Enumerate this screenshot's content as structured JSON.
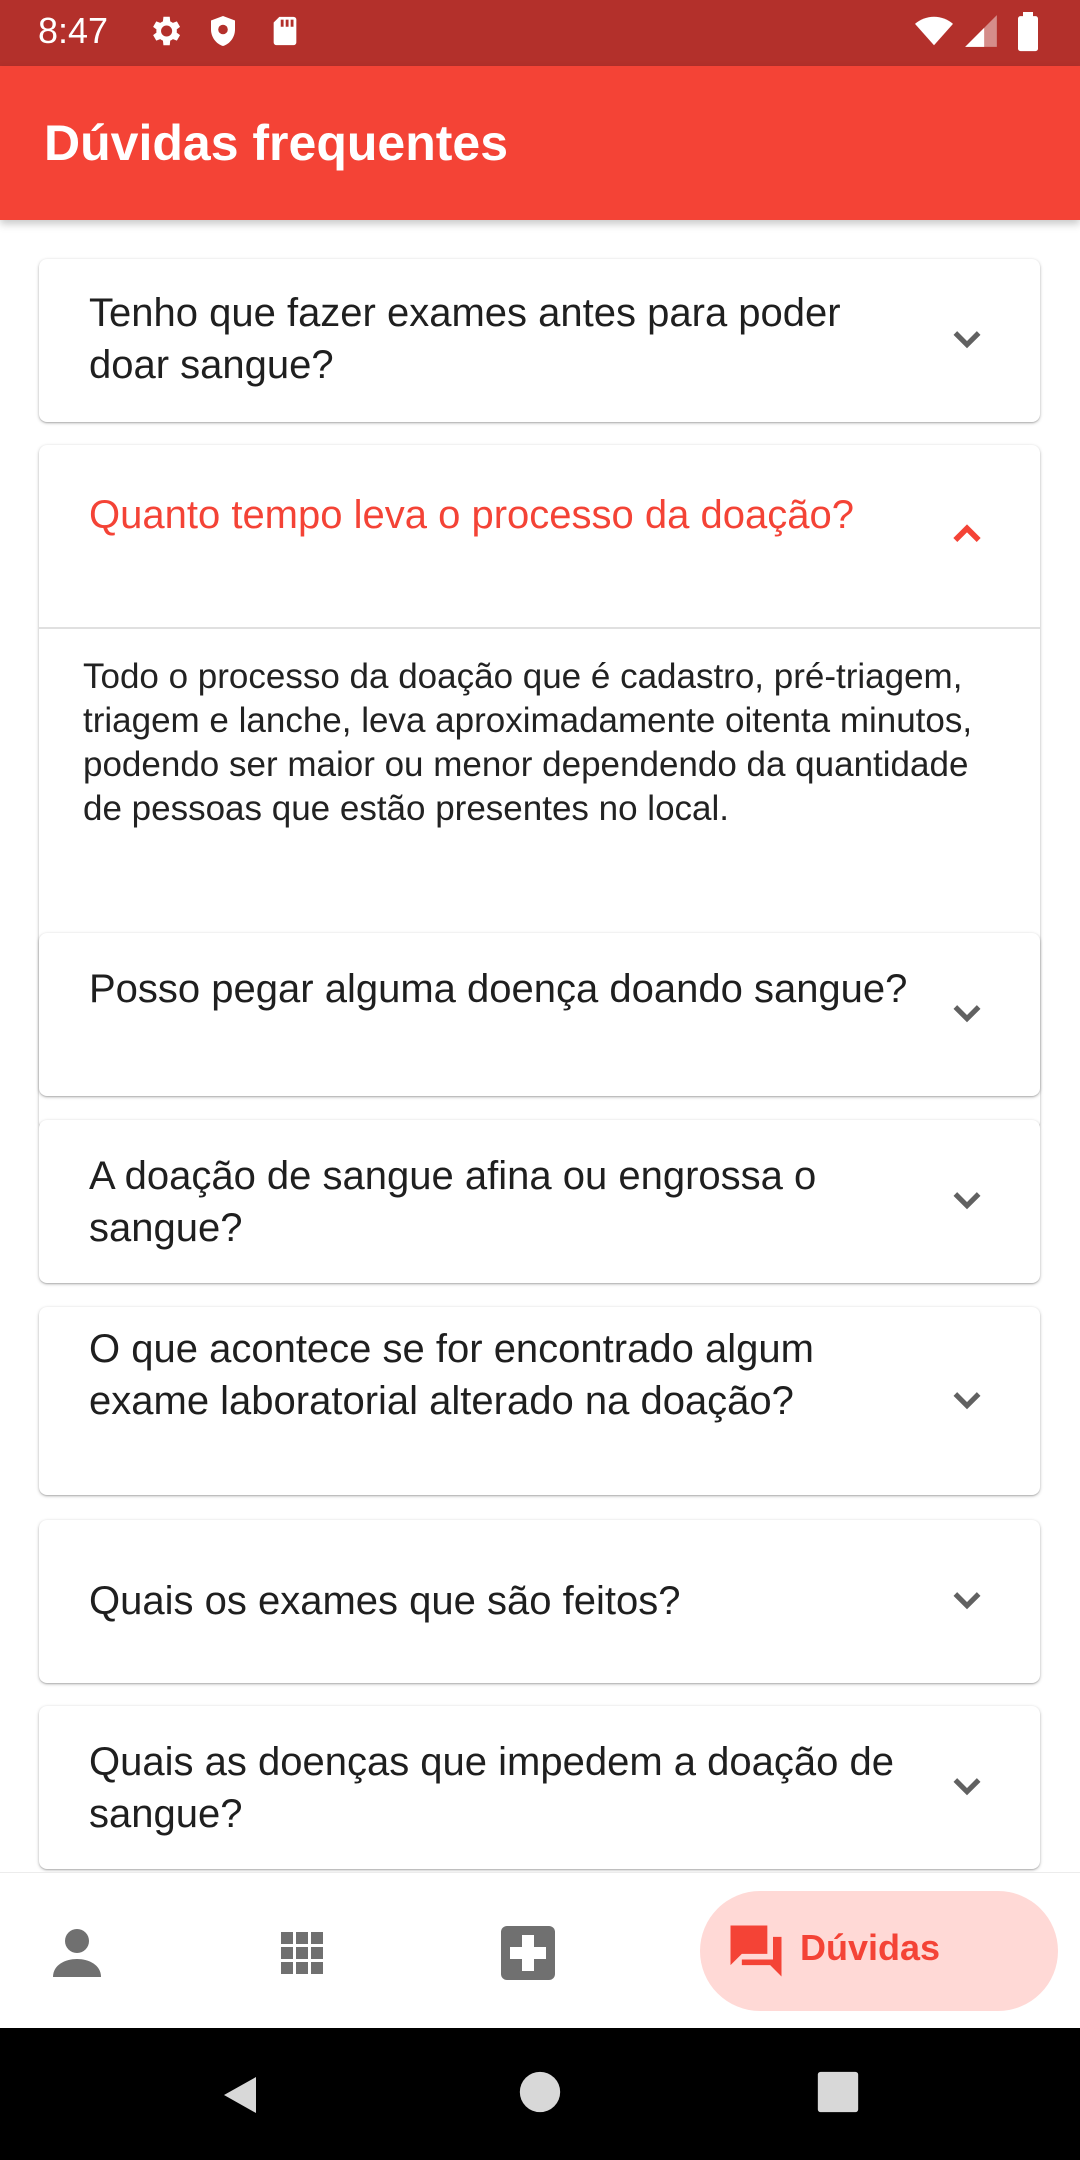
{
  "status_bar": {
    "time": "8:47",
    "icons": [
      "gear-icon",
      "shield-icon",
      "sd-card-icon",
      "wifi-icon",
      "signal-icon",
      "battery-icon"
    ]
  },
  "app_bar": {
    "title": "Dúvidas frequentes"
  },
  "faq": [
    {
      "question": "Tenho que fazer exames antes para poder doar sangue?",
      "expanded": false
    },
    {
      "question": "Quanto tempo leva o processo da doação?",
      "expanded": true,
      "answer": "Todo o processo da doação que é cadastro, pré-triagem, triagem e lanche, leva aproximadamente oitenta minutos, podendo ser maior ou menor dependendo da quantidade de pessoas que estão presentes no local."
    },
    {
      "question": "Posso pegar alguma doença doando sangue?",
      "expanded": false
    },
    {
      "question": "A doação de sangue afina ou engrossa o sangue?",
      "expanded": false
    },
    {
      "question": "O que acontece se for encontrado algum exame laboratorial alterado na doação?",
      "expanded": false
    },
    {
      "question": "Quais os exames que são feitos?",
      "expanded": false
    },
    {
      "question": "Quais as doenças que impedem a doação de sangue?",
      "expanded": false
    }
  ],
  "bottom_nav": {
    "items": [
      {
        "icon": "person-icon"
      },
      {
        "icon": "apps-grid-icon"
      },
      {
        "icon": "medical-cross-icon"
      },
      {
        "icon": "forum-icon",
        "label": "Dúvidas",
        "active": true
      }
    ]
  },
  "colors": {
    "primary": "#f44336",
    "status_bar": "#b3302b",
    "active_nav_bg": "#ffd9d6",
    "text": "#1f1f1f",
    "icon_grey": "#707070"
  }
}
